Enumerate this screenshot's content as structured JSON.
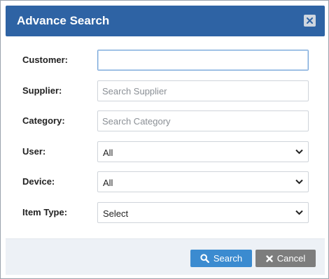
{
  "dialog": {
    "title": "Advance Search",
    "close_icon": "close-icon"
  },
  "form": {
    "customer": {
      "label": "Customer:",
      "value": "",
      "placeholder": ""
    },
    "supplier": {
      "label": "Supplier:",
      "value": "",
      "placeholder": "Search Supplier"
    },
    "category": {
      "label": "Category:",
      "value": "",
      "placeholder": "Search Category"
    },
    "user": {
      "label": "User:",
      "selected": "All"
    },
    "device": {
      "label": "Device:",
      "selected": "All"
    },
    "item_type": {
      "label": "Item Type:",
      "selected": "Select"
    }
  },
  "footer": {
    "search_label": "Search",
    "cancel_label": "Cancel",
    "search_icon": "search-icon",
    "cancel_icon": "x-icon"
  },
  "colors": {
    "header": "#2e63a4",
    "search_button": "#3b8bd0",
    "cancel_button": "#7d7d7d",
    "footer_bg": "#edf1f6"
  }
}
